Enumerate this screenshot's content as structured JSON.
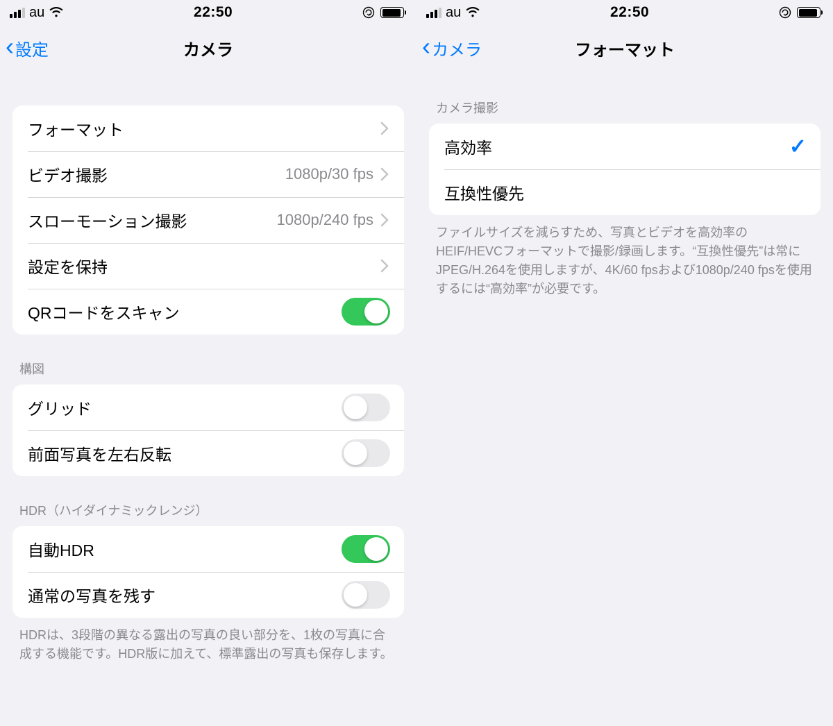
{
  "left": {
    "status": {
      "carrier": "au",
      "time": "22:50"
    },
    "nav": {
      "back": "設定",
      "title": "カメラ"
    },
    "rows": {
      "format": "フォーマット",
      "video": "ビデオ撮影",
      "video_value": "1080p/30 fps",
      "slomo": "スローモーション撮影",
      "slomo_value": "1080p/240 fps",
      "preserve": "設定を保持",
      "qr": "QRコードをスキャン",
      "grid": "グリッド",
      "mirror": "前面写真を左右反転",
      "auto_hdr": "自動HDR",
      "keep_normal": "通常の写真を残す"
    },
    "headers": {
      "composition": "構図",
      "hdr": "HDR（ハイダイナミックレンジ）"
    },
    "footer_hdr": "HDRは、3段階の異なる露出の写真の良い部分を、1枚の写真に合成する機能です。HDR版に加えて、標準露出の写真も保存します。"
  },
  "right": {
    "status": {
      "carrier": "au",
      "time": "22:50"
    },
    "nav": {
      "back": "カメラ",
      "title": "フォーマット"
    },
    "headers": {
      "capture": "カメラ撮影"
    },
    "rows": {
      "high_efficiency": "高効率",
      "most_compatible": "互換性優先"
    },
    "footer": "ファイルサイズを減らすため、写真とビデオを高効率のHEIF/HEVCフォーマットで撮影/録画します。“互換性優先”は常にJPEG/H.264を使用しますが、4K/60 fpsおよび1080p/240 fpsを使用するには“高効率”が必要です。"
  }
}
